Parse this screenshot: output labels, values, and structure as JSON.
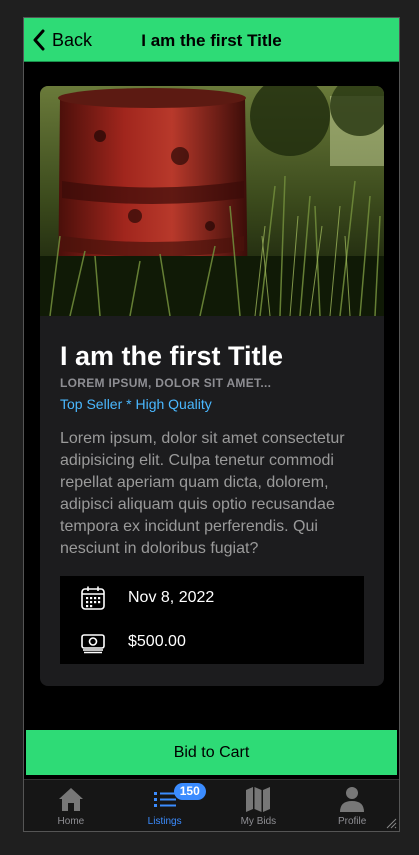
{
  "header": {
    "back_label": "Back",
    "title": "I am the first Title"
  },
  "card": {
    "title": "I am the first Title",
    "subtitle": "LOREM IPSUM, DOLOR SIT AMET...",
    "tagline": "Top Seller * High Quality",
    "description": "Lorem ipsum, dolor sit amet consectetur adipisicing elit. Culpa tenetur commodi repellat aperiam quam dicta, dolorem, adipisci aliquam quis optio recusandae tempora ex incidunt perferendis. Qui nesciunt in doloribus fugiat?",
    "date": "Nov 8, 2022",
    "price": "$500.00",
    "image_icon": "rusty-barrel-photo"
  },
  "cta": {
    "label": "Bid to Cart"
  },
  "tabs": [
    {
      "label": "Home",
      "icon": "home-icon"
    },
    {
      "label": "Listings",
      "icon": "list-icon",
      "badge": "150"
    },
    {
      "label": "My Bids",
      "icon": "map-icon"
    },
    {
      "label": "Profile",
      "icon": "person-icon"
    }
  ],
  "colors": {
    "accent": "#2edb76",
    "link": "#4ab8ff",
    "active_tab": "#3b8cff"
  }
}
